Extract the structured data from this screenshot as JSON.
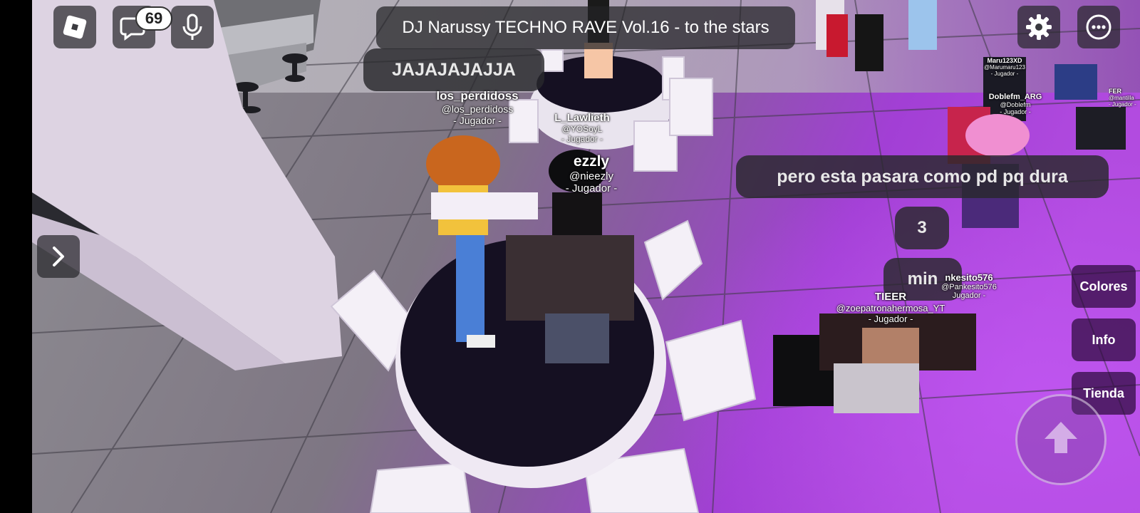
{
  "session": {
    "title": "DJ Narussy TECHNO RAVE Vol.16 - to the stars",
    "chat_unread_count": "69"
  },
  "colors": {
    "floor_gray": "#8d8c91",
    "floor_purple": "#a53fd6",
    "table_top": "#151022",
    "chair_white": "#f3eef6",
    "hud_dark": "#2a2a2e"
  },
  "icons": {
    "logo": "roblox-logo-icon",
    "chat": "chat-icon",
    "mic": "microphone-icon",
    "settings": "gear-icon",
    "more": "more-options-icon",
    "expand": "chevron-right-icon",
    "jump": "arrow-up-icon"
  },
  "chat_bubbles": {
    "laugh": "JAJAJAJAJJA",
    "message": "pero esta pasara como pd pq dura",
    "count": "3",
    "unit": "min"
  },
  "players": [
    {
      "display": "los_perdidoss",
      "handle": "@los_perdidoss",
      "role": "- Jugador -"
    },
    {
      "display": "L_Lawlieth",
      "handle": "@YOSoyL",
      "role": "- Jugador -"
    },
    {
      "display": "ezzly",
      "handle": "@nieezly",
      "role": "- Jugador -"
    },
    {
      "display": "Maru123XD",
      "handle": "@Marumaru123",
      "role": "- Jugador -"
    },
    {
      "display": "Doblefm_ARG",
      "handle": "@Doblefm",
      "role": "- Jugador -"
    },
    {
      "display": "FER",
      "handle": "@mantilla",
      "role": "- Jugador -"
    },
    {
      "display": "nkesito576",
      "handle": "@Pankesito576",
      "role": "Jugador -"
    },
    {
      "display": "TIEER",
      "handle": "@zoepatronahermosa_YT",
      "role": "- Jugador -"
    }
  ],
  "side_menu": {
    "colors": "Colores",
    "info": "Info",
    "store": "Tienda"
  }
}
